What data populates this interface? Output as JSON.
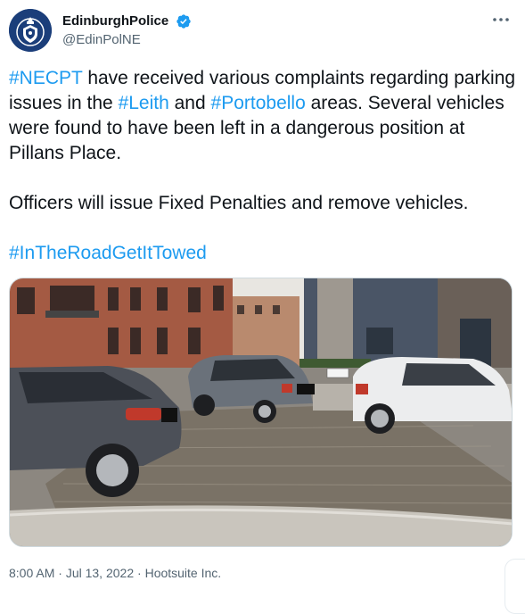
{
  "author": {
    "display_name": "EdinburghPolice",
    "handle": "@EdinPolNE",
    "verified": true,
    "avatar_icon": "police-badge-icon"
  },
  "more_icon": "more-horizontal-icon",
  "tweet": {
    "seg1": "#NECPT",
    "seg2": " have received various complaints regarding parking issues in the ",
    "seg3": "#Leith",
    "seg4": " and ",
    "seg5": "#Portobello",
    "seg6": " areas. Several vehicles were found to have been left in a dangerous position at Pillans Place.\n\nOfficers will issue Fixed Penalties and remove vehicles.\n\n",
    "seg7": "#InTheRoadGetItTowed"
  },
  "media": {
    "description_icon": "photo-icon"
  },
  "meta": {
    "time": "8:00 AM",
    "sep1": " · ",
    "date": "Jul 13, 2022",
    "sep2": " · ",
    "source": "Hootsuite Inc."
  },
  "colors": {
    "link": "#1d9bf0",
    "secondary_text": "#536471",
    "verified": "#1d9bf0"
  }
}
